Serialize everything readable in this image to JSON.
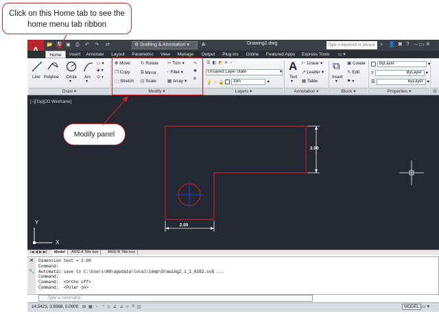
{
  "titlebar": {
    "workspace": "Drafting & Annotation",
    "document": "Drawing2.dwg",
    "search_placeholder": "Type a keyword or phrase"
  },
  "tabs": [
    "Home",
    "Insert",
    "Annotate",
    "Layout",
    "Parametric",
    "View",
    "Manage",
    "Output",
    "Plug-ins",
    "Online",
    "Featured Apps",
    "Express Tools"
  ],
  "draw": {
    "line": "Line",
    "polyline": "Polyline",
    "circle": "Circle",
    "arc": "Arc",
    "title": "Draw"
  },
  "modify": {
    "move": "Move",
    "rotate": "Rotate",
    "trim": "Trim",
    "copy": "Copy",
    "mirror": "Mirror",
    "fillet": "Fillet",
    "stretch": "Stretch",
    "scale": "Scale",
    "array": "Array",
    "title": "Modify"
  },
  "layers": {
    "state": "Unsaved Layer State",
    "current": "Dim",
    "title": "Layers"
  },
  "annotation": {
    "text": "Text",
    "linear": "Linear",
    "leader": "Leader",
    "table": "Table",
    "title": "Annotation"
  },
  "block": {
    "insert": "Insert",
    "create": "Create",
    "edit": "Edit",
    "title": "Block"
  },
  "properties": {
    "color": "ByLayer",
    "linetype": "ByLayer",
    "lineweight": "ByLayer",
    "title": "Properties"
  },
  "viewport": {
    "label": "[−][Top][2D Wireframe]",
    "dim_horizontal": "2.00",
    "dim_vertical": "2.00",
    "axis_y": "Y",
    "axis_x": "X"
  },
  "layout_tabs": [
    "Model",
    "ANSI A Title box",
    "ANSI B Title box"
  ],
  "command": {
    "lines": [
      "Dimension text = 2.00",
      "Command:",
      "Automatic save to C:\\Users\\NN\\appdata\\local\\temp\\Drawing2_1_1_0282.sv$ ...",
      "Command:",
      "Command:  <Ortho off>",
      "Command:  <Polar on>"
    ],
    "placeholder": "Type a command"
  },
  "status": {
    "coords": "14.5423, 3.9368, 0.0000",
    "model": "MODEL"
  },
  "callouts": {
    "home_tab": "Click on this Home tab to see the home menu tab ribbon",
    "modify_panel": "Modify panel"
  },
  "colors": {
    "accent": "#c1272d",
    "viewport_bg": "#232833",
    "geometry": "#e02020",
    "circle_center": "#1a3fd8"
  }
}
